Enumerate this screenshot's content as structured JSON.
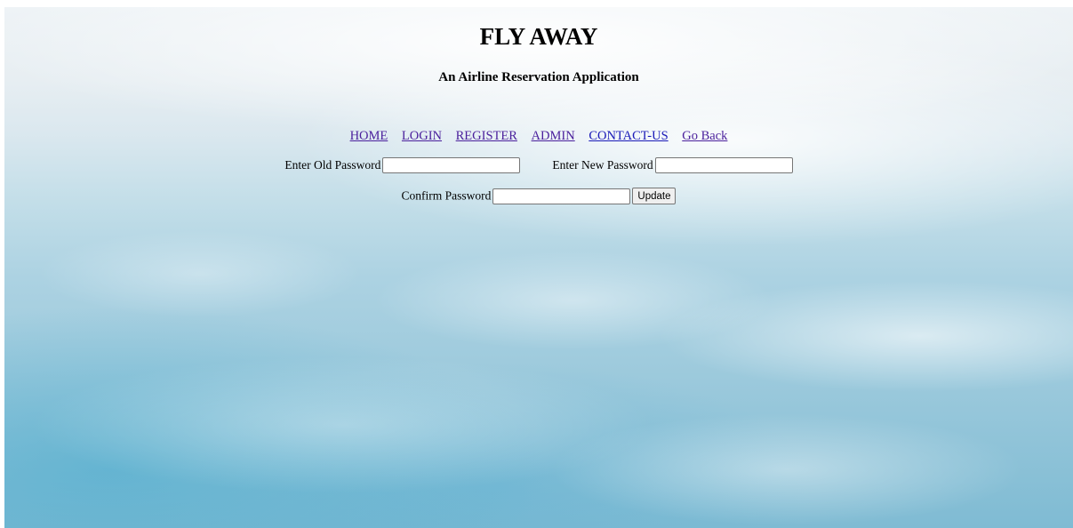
{
  "header": {
    "title": "FLY AWAY",
    "subtitle": "An Airline Reservation Application"
  },
  "nav": {
    "items": [
      {
        "label": "HOME"
      },
      {
        "label": "LOGIN"
      },
      {
        "label": "REGISTER"
      },
      {
        "label": "ADMIN"
      },
      {
        "label": "CONTACT-US"
      },
      {
        "label": "Go Back"
      }
    ]
  },
  "form": {
    "old_password_label": "Enter Old Password",
    "old_password_value": "",
    "new_password_label": "Enter New Password",
    "new_password_value": "",
    "confirm_password_label": "Confirm Password",
    "confirm_password_value": "",
    "update_label": "Update"
  },
  "colors": {
    "visited_link": "#4a1f9c",
    "link": "#1a1ab8",
    "sky_top": "#eef3f6",
    "sky_bottom": "#7fbbd3"
  }
}
